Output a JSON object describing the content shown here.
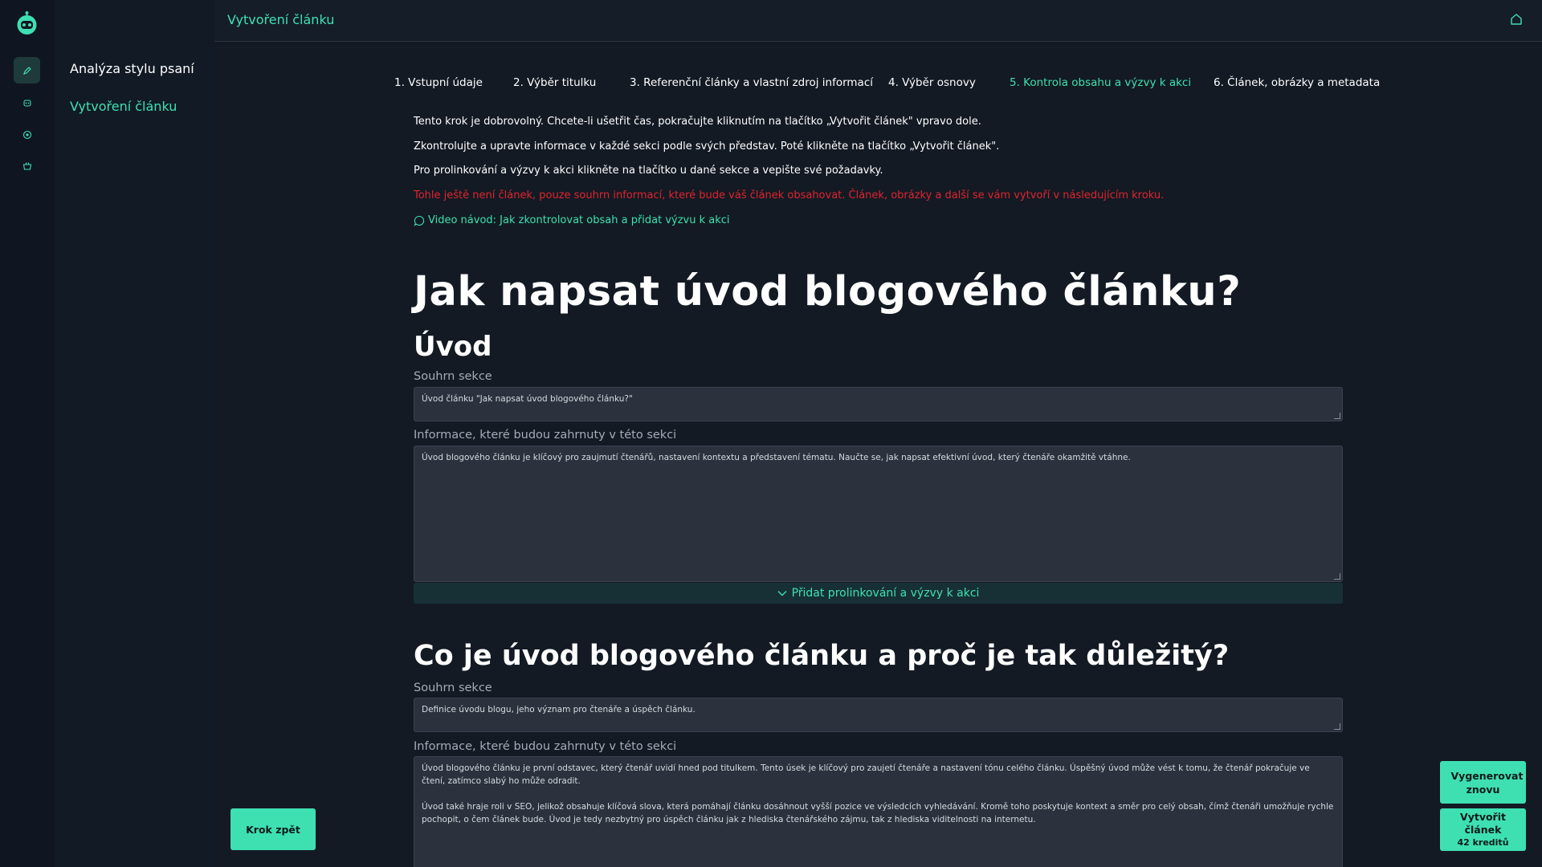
{
  "sidebar": {
    "items": [
      {
        "label": "Analýza stylu psaní"
      },
      {
        "label": "Vytvoření článku"
      }
    ]
  },
  "header": {
    "title": "Vytvoření článku"
  },
  "steps": [
    {
      "label": "1. Vstupní údaje"
    },
    {
      "label": "2. Výběr titulku"
    },
    {
      "label": "3. Referenční články a vlastní zdroj informací"
    },
    {
      "label": "4. Výběr osnovy"
    },
    {
      "label": "5. Kontrola obsahu a výzvy k akci"
    },
    {
      "label": "6. Článek, obrázky a metadata"
    }
  ],
  "intro": {
    "line1": "Tento krok je dobrovolný. Chcete-li ušetřit čas, pokračujte kliknutím na tlačítko „Vytvořit článek\" vpravo dole.",
    "line2": "Zkontrolujte a upravte informace v každé sekci podle svých představ. Poté klikněte na tlačítko „Vytvořit článek\".",
    "line3": "Pro prolinkování a výzvy k akci klikněte na tlačítko u dané sekce a vepište své požadavky.",
    "warning": "Tohle ještě není článek, pouze souhrn informací, které bude váš článek obsahovat. Článek, obrázky a další se vám vytvoří v následujícím kroku.",
    "video_link": "Video návod: Jak zkontrolovat obsah a přidat výzvu k akci"
  },
  "article": {
    "title": "Jak napsat úvod blogového článku?",
    "sections": [
      {
        "heading": "Úvod",
        "summary_label": "Souhrn sekce",
        "summary": "Úvod článku \"Jak napsat úvod blogového článku?\"",
        "info_label": "Informace, které budou zahrnuty v této sekci",
        "info": "Úvod blogového článku je klíčový pro zaujmutí čtenářů, nastavení kontextu a představení tématu. Naučte se, jak napsat efektivní úvod, který čtenáře okamžitě vtáhne.",
        "expand_label": "Přidat prolinkování a výzvy k akci"
      },
      {
        "heading": "Co je úvod blogového článku a proč je tak důležitý?",
        "summary_label": "Souhrn sekce",
        "summary": "Definice úvodu blogu, jeho význam pro čtenáře a úspěch článku.",
        "info_label": "Informace, které budou zahrnuty v této sekci",
        "info_p1": "Úvod blogového článku je první odstavec, který čtenář uvidí hned pod titulkem. Tento úsek je klíčový pro zaujetí čtenáře a nastavení tónu celého článku. Úspěšný úvod může vést k tomu, že čtenář pokračuje ve čtení, zatímco slabý ho může odradit.",
        "info_p2": "Úvod také hraje roli v SEO, jelikož obsahuje klíčová slova, která pomáhají článku dosáhnout vyšší pozice ve výsledcích vyhledávání. Kromě toho poskytuje kontext a směr pro celý obsah, čímž čtenáři umožňuje rychle pochopit, o čem článek bude. Úvod je tedy nezbytný pro úspěch článku jak z hlediska čtenářského zájmu, tak z hlediska viditelnosti na internetu."
      }
    ]
  },
  "buttons": {
    "back": "Krok zpět",
    "regenerate": "Vygenerovat znovu",
    "create": "Vytvořit článek",
    "create_sub": "42 kreditů"
  },
  "colors": {
    "accent": "#3ee0b1",
    "warning": "#e0242e",
    "background": "#131a24"
  }
}
